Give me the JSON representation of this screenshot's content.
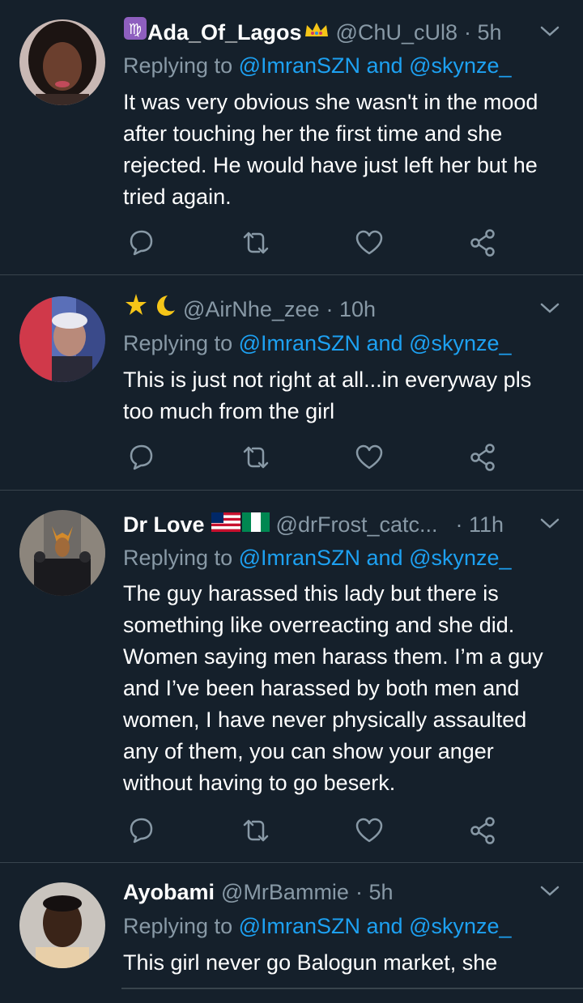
{
  "tweets": [
    {
      "name": "Ada_Of_Lagos",
      "handle": "@ChU_cUl8",
      "time": "· 5h",
      "reply_prefix": "Replying to ",
      "reply_mentions": "@ImranSZN and @skynze_",
      "text": "It was very obvious she wasn't in the mood after touching her the first time and she rejected. He would have just left her but he tried again."
    },
    {
      "name": "",
      "handle": "@AirNhe_zee",
      "time": "· 10h",
      "reply_prefix": "Replying to ",
      "reply_mentions": "@ImranSZN and @skynze_",
      "text": "This is just not right at all...in everyway pls  too much from the girl"
    },
    {
      "name": "Dr Love",
      "handle": "@drFrost_catc...",
      "time": "· 11h",
      "reply_prefix": "Replying to ",
      "reply_mentions": "@ImranSZN and @skynze_",
      "text": "The guy harassed this lady but there is something like overreacting and she did. Women saying men harass them. I’m a guy and I’ve been harassed by both men and women, I have never physically assaulted any of them, you can show your anger without having to go beserk."
    },
    {
      "name": "Ayobami",
      "handle": "@MrBammie",
      "time": "· 5h",
      "reply_prefix": "Replying to ",
      "reply_mentions": "@ImranSZN and @skynze_",
      "text": "This girl never go Balogun market, she"
    }
  ],
  "icons": {
    "reply": "reply-icon",
    "retweet": "retweet-icon",
    "like": "heart-icon",
    "share": "share-icon",
    "more": "chevron-down-icon"
  },
  "colors": {
    "background": "#15202b",
    "muted": "#8899a6",
    "link": "#1da1f2",
    "divider": "#38444d"
  }
}
